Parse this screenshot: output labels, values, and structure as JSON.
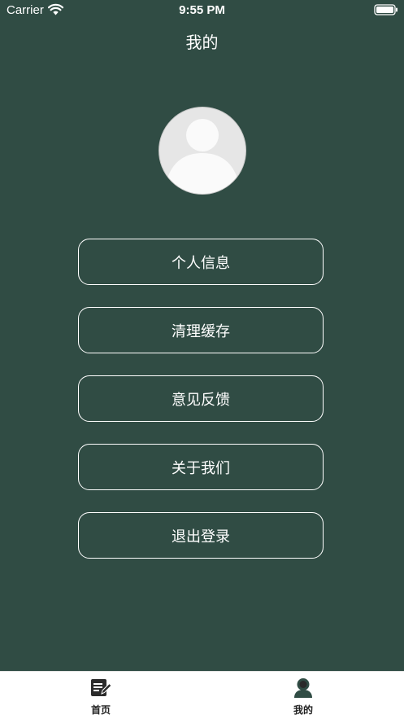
{
  "status_bar": {
    "carrier": "Carrier",
    "time": "9:55 PM"
  },
  "nav": {
    "title": "我的"
  },
  "menu": {
    "items": [
      {
        "label": "个人信息"
      },
      {
        "label": "清理缓存"
      },
      {
        "label": "意见反馈"
      },
      {
        "label": "关于我们"
      },
      {
        "label": "退出登录"
      }
    ]
  },
  "tabs": [
    {
      "label": "首页",
      "icon": "edit-note-icon"
    },
    {
      "label": "我的",
      "icon": "user-profile-icon"
    }
  ],
  "colors": {
    "background": "#304c44",
    "text": "#ffffff",
    "tab_bar": "#ffffff"
  }
}
